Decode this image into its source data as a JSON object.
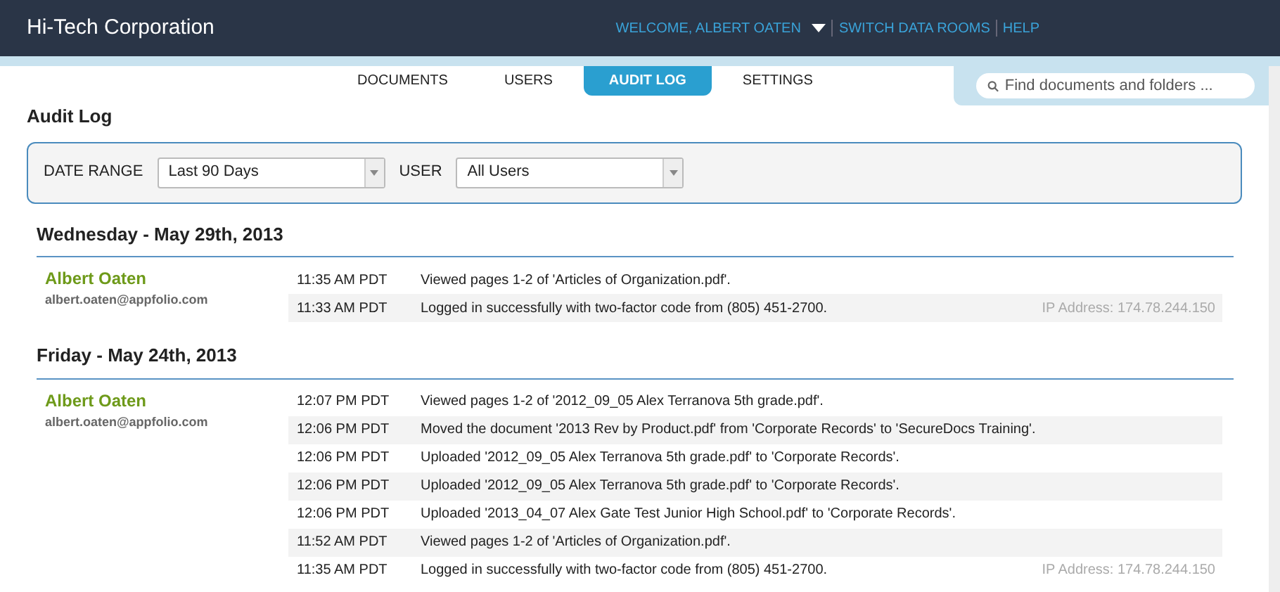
{
  "header": {
    "title": "Hi-Tech Corporation",
    "links": [
      {
        "label": "WELCOME, ALBERT OATEN",
        "kind": "menu"
      },
      {
        "label": "SWITCH DATA ROOMS",
        "kind": "link"
      },
      {
        "label": "HELP",
        "kind": "link"
      }
    ]
  },
  "tabs": [
    {
      "label": "DOCUMENTS",
      "selected": false
    },
    {
      "label": "USERS",
      "selected": false
    },
    {
      "label": "AUDIT LOG",
      "selected": true
    },
    {
      "label": "SETTINGS",
      "selected": false
    }
  ],
  "search": {
    "placeholder": "Find documents and folders ..."
  },
  "page_title": "Audit Log",
  "filters": [
    {
      "label": "DATE RANGE",
      "value": "Last 90 Days"
    },
    {
      "label": "USER",
      "value": "All Users"
    }
  ],
  "days": [
    {
      "date": "Wednesday - May 29th, 2013",
      "user": "Albert Oaten",
      "email": "albert.oaten@appfolio.com",
      "events": [
        {
          "time": "11:35 AM PDT",
          "text": "Viewed pages 1-2 of 'Articles of Organization.pdf'."
        },
        {
          "time": "11:33 AM PDT",
          "text": "Logged in successfully with two-factor code from (805) 451-2700.",
          "ip": "IP Address: 174.78.244.150"
        }
      ]
    },
    {
      "date": "Friday - May 24th, 2013",
      "user": "Albert Oaten",
      "email": "albert.oaten@appfolio.com",
      "events": [
        {
          "time": "12:07 PM PDT",
          "text": "Viewed pages 1-2 of '2012_09_05 Alex Terranova 5th grade.pdf'."
        },
        {
          "time": "12:06 PM PDT",
          "text": "Moved the document '2013 Rev by Product.pdf' from 'Corporate Records' to 'SecureDocs Training'."
        },
        {
          "time": "12:06 PM PDT",
          "text": "Uploaded '2012_09_05 Alex Terranova 5th grade.pdf' to 'Corporate Records'."
        },
        {
          "time": "12:06 PM PDT",
          "text": "Uploaded '2012_09_05 Alex Terranova 5th grade.pdf' to 'Corporate Records'."
        },
        {
          "time": "12:06 PM PDT",
          "text": "Uploaded '2013_04_07 Alex Gate Test Junior High School.pdf' to 'Corporate Records'."
        },
        {
          "time": "11:52 AM PDT",
          "text": "Viewed pages 1-2 of 'Articles of Organization.pdf'."
        },
        {
          "time": "11:35 AM PDT",
          "text": "Logged in successfully with two-factor code from (805) 451-2700.",
          "ip": "IP Address: 174.78.244.150"
        }
      ]
    }
  ]
}
